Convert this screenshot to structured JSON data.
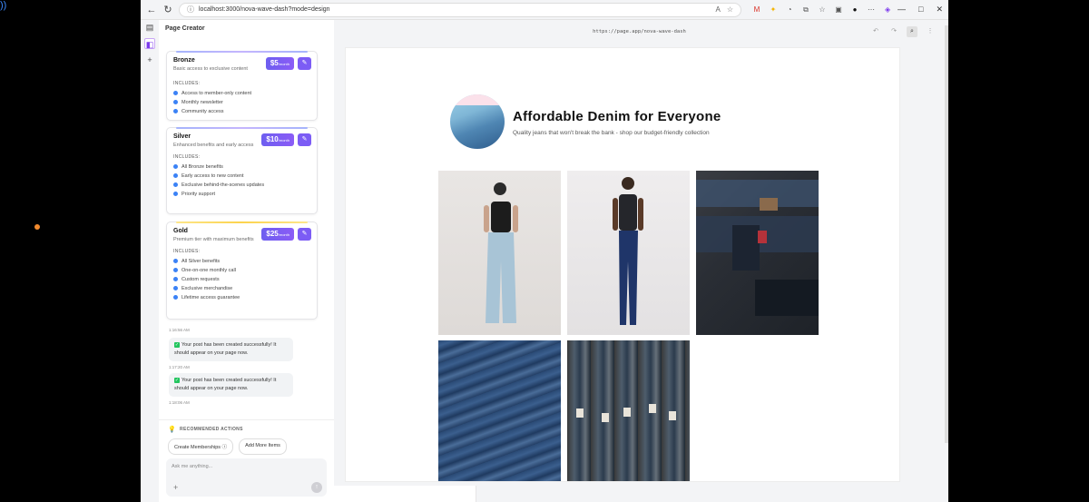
{
  "browser": {
    "url": "localhost:3000/nova-wave-dash?mode=design",
    "window_controls": [
      "—",
      "□",
      "✕"
    ]
  },
  "panel": {
    "title": "Page Creator",
    "tiers": [
      {
        "name": "Bronze",
        "description": "Basic access to exclusive content",
        "price": "$5",
        "period": "/month",
        "includes_label": "INCLUDES:",
        "features": [
          "Access to member-only content",
          "Monthly newsletter",
          "Community access"
        ]
      },
      {
        "name": "Silver",
        "description": "Enhanced benefits and early access",
        "price": "$10",
        "period": "/month",
        "includes_label": "INCLUDES:",
        "features": [
          "All Bronze benefits",
          "Early access to new content",
          "Exclusive behind-the-scenes updates",
          "Priority support"
        ]
      },
      {
        "name": "Gold",
        "description": "Premium tier with maximum benefits",
        "price": "$25",
        "period": "/month",
        "includes_label": "INCLUDES:",
        "features": [
          "All Silver benefits",
          "One-on-one monthly call",
          "Custom requests",
          "Exclusive merchandise",
          "Lifetime access guarantee"
        ]
      }
    ],
    "timestamps": [
      "1:16:56 AM",
      "1:17:20 AM",
      "1:18:06 AM"
    ],
    "messages": [
      "Your post has been created successfully! It should appear on your page now.",
      "Your post has been created successfully! It should appear on your page now."
    ],
    "recommended": {
      "title": "RECOMMENDED ACTIONS",
      "actions": [
        "Create Memberships",
        "Add More Items"
      ]
    },
    "composer": {
      "placeholder": "Ask me anything..."
    }
  },
  "preview": {
    "url": "https://page.app/nova-wave-dash",
    "title": "Affordable Denim for Everyone",
    "subtitle": "Quality jeans that won't break the bank - shop our budget-friendly collection"
  },
  "colors": {
    "accent": "#7c5cf5",
    "check": "#3b82f6",
    "success": "#22c55e"
  }
}
